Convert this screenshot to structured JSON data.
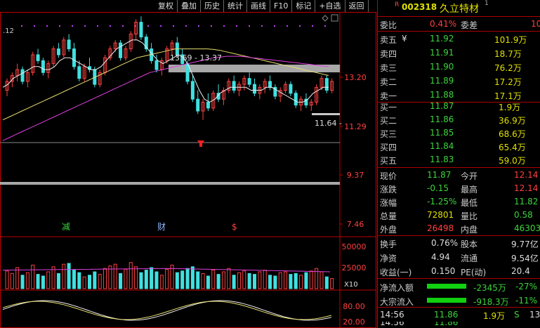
{
  "toolbar": {
    "items": [
      "复权",
      "叠加",
      "历史",
      "统计",
      "画线",
      "F10",
      "标记",
      "+自选",
      "返回"
    ]
  },
  "header": {
    "code": "002318",
    "name": "久立特材",
    "superscript": "1",
    "left_marker": "R"
  },
  "chart": {
    "price_labels": [
      "13.20",
      "11.29",
      "9.37",
      "7.46"
    ],
    "top_left_label": ".12",
    "band_label": "13.69 - 13.37",
    "current_label": "11.64 -",
    "event_labels": [
      {
        "text": "减",
        "color": "#3cd43c"
      },
      {
        "text": "财",
        "color": "#8ab4ff"
      },
      {
        "text": "$",
        "color": "#ff4040"
      }
    ],
    "volume_labels": [
      "50000",
      "25000"
    ],
    "volume_unit": "X10",
    "indicator_labels": [
      "80.00",
      "20.00"
    ]
  },
  "chart_data": {
    "type": "candlestick",
    "ylim": [
      7.0,
      14.5
    ],
    "candles": [
      [
        11.9,
        12.3,
        11.7,
        12.2
      ],
      [
        12.2,
        12.5,
        12.0,
        12.4
      ],
      [
        12.4,
        12.8,
        12.2,
        12.6
      ],
      [
        12.6,
        12.7,
        12.1,
        12.2
      ],
      [
        12.2,
        12.6,
        12.0,
        12.5
      ],
      [
        12.5,
        13.2,
        12.4,
        13.1
      ],
      [
        13.1,
        13.3,
        12.8,
        12.9
      ],
      [
        12.9,
        13.0,
        12.4,
        12.5
      ],
      [
        12.5,
        12.9,
        12.3,
        12.8
      ],
      [
        12.8,
        13.4,
        12.7,
        13.3
      ],
      [
        13.3,
        13.5,
        13.0,
        13.1
      ],
      [
        13.1,
        13.7,
        13.0,
        13.6
      ],
      [
        13.6,
        13.8,
        13.2,
        13.3
      ],
      [
        13.3,
        13.5,
        12.6,
        12.7
      ],
      [
        12.7,
        12.9,
        12.2,
        12.3
      ],
      [
        12.3,
        12.8,
        12.2,
        12.7
      ],
      [
        12.7,
        13.0,
        12.5,
        12.6
      ],
      [
        12.6,
        12.7,
        12.0,
        12.1
      ],
      [
        12.1,
        12.6,
        12.0,
        12.5
      ],
      [
        12.5,
        13.1,
        12.4,
        13.0
      ],
      [
        13.0,
        13.4,
        12.9,
        13.3
      ],
      [
        13.3,
        13.6,
        13.2,
        13.5
      ],
      [
        13.5,
        13.6,
        12.9,
        13.0
      ],
      [
        13.0,
        13.4,
        12.9,
        13.3
      ],
      [
        13.3,
        13.9,
        13.2,
        13.8
      ],
      [
        13.8,
        14.3,
        13.6,
        14.2
      ],
      [
        14.2,
        14.4,
        13.6,
        13.7
      ],
      [
        13.7,
        13.8,
        13.2,
        13.3
      ],
      [
        13.3,
        13.5,
        12.8,
        12.9
      ],
      [
        12.9,
        13.1,
        12.5,
        12.6
      ],
      [
        12.6,
        13.0,
        12.4,
        12.9
      ],
      [
        12.9,
        13.4,
        12.8,
        13.3
      ],
      [
        13.3,
        13.6,
        13.1,
        13.5
      ],
      [
        13.5,
        13.7,
        13.0,
        13.1
      ],
      [
        13.1,
        13.3,
        12.7,
        12.8
      ],
      [
        12.8,
        12.9,
        12.1,
        12.2
      ],
      [
        12.2,
        12.4,
        11.5,
        11.6
      ],
      [
        11.6,
        11.9,
        11.1,
        11.2
      ],
      [
        11.2,
        11.6,
        10.9,
        11.5
      ],
      [
        11.5,
        11.8,
        11.2,
        11.3
      ],
      [
        11.3,
        11.9,
        11.2,
        11.8
      ],
      [
        11.8,
        12.1,
        11.5,
        11.6
      ],
      [
        11.6,
        12.0,
        11.4,
        11.9
      ],
      [
        11.9,
        12.3,
        11.8,
        12.2
      ],
      [
        12.2,
        12.4,
        11.8,
        11.9
      ],
      [
        11.9,
        12.2,
        11.7,
        12.1
      ],
      [
        12.1,
        12.4,
        11.9,
        12.3
      ],
      [
        12.3,
        12.5,
        12.0,
        12.1
      ],
      [
        12.1,
        12.3,
        11.7,
        11.8
      ],
      [
        11.8,
        12.1,
        11.6,
        12.0
      ],
      [
        12.0,
        12.3,
        11.8,
        12.2
      ],
      [
        12.2,
        12.4,
        11.9,
        12.0
      ],
      [
        12.0,
        12.1,
        11.6,
        11.7
      ],
      [
        11.7,
        12.0,
        11.5,
        11.9
      ],
      [
        11.9,
        12.2,
        11.8,
        12.1
      ],
      [
        12.1,
        12.2,
        11.7,
        11.8
      ],
      [
        11.8,
        11.9,
        11.3,
        11.4
      ],
      [
        11.4,
        11.7,
        11.2,
        11.6
      ],
      [
        11.6,
        11.8,
        11.3,
        11.4
      ],
      [
        11.4,
        11.6,
        11.2,
        11.5
      ],
      [
        11.5,
        12.1,
        11.4,
        12.0
      ],
      [
        12.0,
        12.4,
        11.9,
        12.3
      ],
      [
        12.3,
        12.4,
        11.8,
        11.9
      ],
      [
        11.9,
        12.3,
        11.8,
        12.2
      ]
    ],
    "ma_yellow": [
      10.9,
      11.0,
      11.1,
      11.2,
      11.3,
      11.4,
      11.5,
      11.6,
      11.7,
      11.8,
      11.9,
      12.0,
      12.1,
      12.2,
      12.3,
      12.4,
      12.5,
      12.6,
      12.7,
      12.8,
      12.9,
      13.0,
      13.05,
      13.1,
      13.15,
      13.2,
      13.25,
      13.3,
      13.3,
      13.3,
      13.3,
      13.3,
      13.3,
      13.28,
      13.25,
      13.2,
      13.15,
      13.1,
      13.05,
      13.0,
      12.95,
      12.9,
      12.85,
      12.8,
      12.75,
      12.7,
      12.65,
      12.6,
      12.55,
      12.5,
      12.45,
      12.4
    ],
    "ma_magenta": [
      10.2,
      10.3,
      10.4,
      10.5,
      10.6,
      10.7,
      10.8,
      10.9,
      11.0,
      11.1,
      11.2,
      11.3,
      11.4,
      11.5,
      11.6,
      11.7,
      11.8,
      11.9,
      12.0,
      12.1,
      12.2,
      12.3,
      12.4,
      12.5,
      12.55,
      12.6,
      12.65,
      12.7,
      12.75,
      12.8,
      12.85,
      12.9,
      12.95,
      13.0,
      13.02,
      13.05,
      13.05,
      13.05,
      13.03,
      13.0,
      12.98,
      12.95,
      12.93,
      12.9,
      12.88,
      12.85,
      12.83,
      12.8,
      12.78,
      12.75,
      12.72,
      12.7
    ],
    "ma_white": [
      12.0,
      12.1,
      12.3,
      12.4,
      12.5,
      12.6,
      12.7,
      12.7,
      12.6,
      12.6,
      12.7,
      12.9,
      13.0,
      13.0,
      12.9,
      12.8,
      12.7,
      12.6,
      12.6,
      12.7,
      12.9,
      13.1,
      13.3,
      13.4,
      13.5,
      13.6,
      13.6,
      13.5,
      13.3,
      13.1,
      12.9,
      12.8,
      12.9,
      13.0,
      13.1,
      13.0,
      12.7,
      12.3,
      11.9,
      11.6,
      11.5,
      11.6,
      11.8,
      11.9,
      12.0,
      12.0,
      12.0,
      12.0,
      11.9,
      11.9,
      11.9,
      12.0,
      12.0,
      11.9,
      11.8,
      11.7,
      11.6,
      11.5,
      11.5,
      11.6,
      11.8,
      11.9,
      12.0,
      12.0
    ],
    "volumes": [
      2.1,
      1.8,
      2.5,
      1.6,
      1.9,
      2.8,
      1.7,
      1.5,
      2.0,
      2.6,
      1.8,
      2.9,
      3.0,
      2.2,
      1.9,
      1.4,
      1.6,
      2.0,
      1.7,
      2.4,
      2.7,
      2.9,
      1.8,
      2.3,
      3.1,
      2.6,
      1.9,
      2.2,
      2.5,
      2.0,
      1.6,
      2.3,
      2.8,
      1.9,
      2.1,
      2.4,
      2.6,
      2.0,
      1.8,
      1.5,
      2.2,
      1.7,
      2.0,
      2.4,
      1.6,
      1.9,
      2.1,
      1.8,
      1.7,
      2.0,
      2.2,
      1.6,
      1.5,
      1.9,
      2.0,
      1.7,
      1.8,
      1.6,
      1.9,
      2.1,
      2.4,
      2.0,
      1.4,
      1.2
    ],
    "volume_ylim": [
      0,
      6
    ]
  },
  "quote": {
    "weibi": {
      "label": "委比",
      "value": "0.41%",
      "label2": "委差",
      "value2": "10"
    },
    "asks": [
      {
        "label": "卖五",
        "mark": "¥",
        "price": "11.92",
        "vol": "101.9万"
      },
      {
        "label": "卖四",
        "mark": "",
        "price": "11.91",
        "vol": "18.7万"
      },
      {
        "label": "卖三",
        "mark": "",
        "price": "11.90",
        "vol": "76.2万"
      },
      {
        "label": "卖二",
        "mark": "",
        "price": "11.89",
        "vol": "17.2万"
      },
      {
        "label": "卖一",
        "mark": "",
        "price": "11.88",
        "vol": "17.1万"
      }
    ],
    "bids": [
      {
        "label": "买一",
        "price": "11.87",
        "vol": "1.9万"
      },
      {
        "label": "买二",
        "price": "11.86",
        "vol": "36.9万"
      },
      {
        "label": "买三",
        "price": "11.85",
        "vol": "68.6万"
      },
      {
        "label": "买四",
        "price": "11.84",
        "vol": "65.4万"
      },
      {
        "label": "买五",
        "price": "11.83",
        "vol": "59.0万"
      }
    ],
    "stats": [
      {
        "l1": "现价",
        "v1": "11.87",
        "c1": "grn",
        "l2": "今开",
        "v2": "12.14",
        "c2": "red"
      },
      {
        "l1": "涨跌",
        "v1": "-0.15",
        "c1": "grn",
        "l2": "最高",
        "v2": "12.14",
        "c2": "red"
      },
      {
        "l1": "涨幅",
        "v1": "-1.25%",
        "c1": "grn",
        "l2": "最低",
        "v2": "11.82",
        "c2": "grn"
      },
      {
        "l1": "总量",
        "v1": "72801",
        "c1": "yel",
        "l2": "量比",
        "v2": "0.58",
        "c2": "grn"
      },
      {
        "l1": "外盘",
        "v1": "26498",
        "c1": "red",
        "l2": "内盘",
        "v2": "46303",
        "c2": "grn"
      }
    ],
    "stats2": [
      {
        "l1": "换手",
        "v1": "0.76%",
        "l2": "股本",
        "v2": "9.77亿"
      },
      {
        "l1": "净资",
        "v1": "4.94",
        "l2": "流通",
        "v2": "9.54亿"
      },
      {
        "l1": "收益(一)",
        "v1": "0.150",
        "l2": "PE(动)",
        "v2": "20.4"
      }
    ],
    "flows": [
      {
        "label": "净流入额",
        "value": "-2345万",
        "pct": "-27%"
      },
      {
        "label": "大宗流入",
        "value": "-918.3万",
        "pct": "-11%"
      }
    ],
    "tick": {
      "time": "14:56",
      "price": "11.86",
      "vol": "1.9万",
      "side": "S",
      "extra": "13"
    },
    "bottom_tick": {
      "time": "14:56",
      "price": "11.86"
    }
  },
  "colors": {
    "up": "#ff4040",
    "down": "#40e0e0",
    "yellow": "#e8e070",
    "magenta": "#e040e0",
    "white": "#f0f0f0",
    "frame": "#c00000"
  }
}
